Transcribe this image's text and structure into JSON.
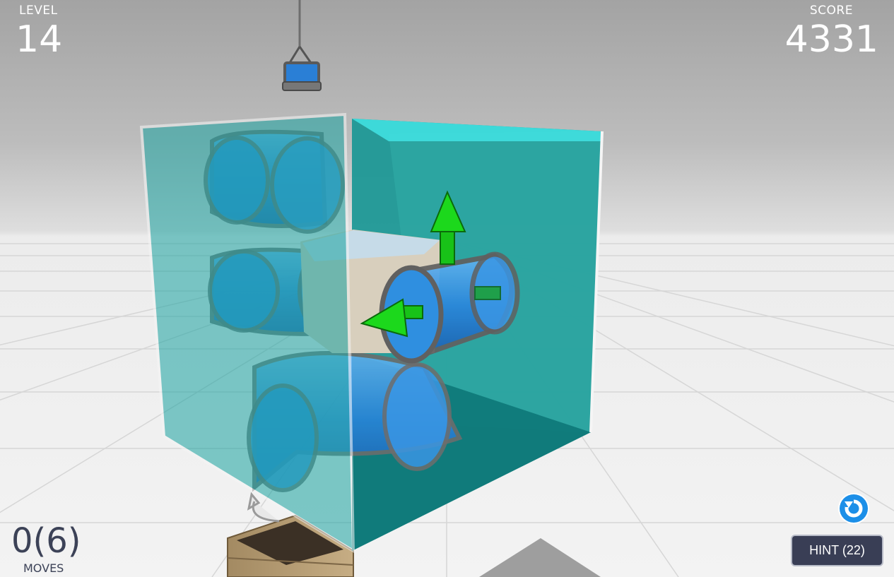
{
  "hud": {
    "level_label": "LEVEL",
    "level_value": "14",
    "score_label": "SCORE",
    "score_value": "4331",
    "moves_value": "0(6)",
    "moves_label": "MOVES"
  },
  "controls": {
    "hint_label": "HINT (22)",
    "reset_icon": "rotate-reset-icon"
  },
  "colors": {
    "glass_teal": "#1f9e9c",
    "pipe_blue": "#2f8fe0",
    "arrow_green": "#17c617",
    "hint_bg": "#393e55",
    "reset_blue": "#1c8fe8"
  }
}
